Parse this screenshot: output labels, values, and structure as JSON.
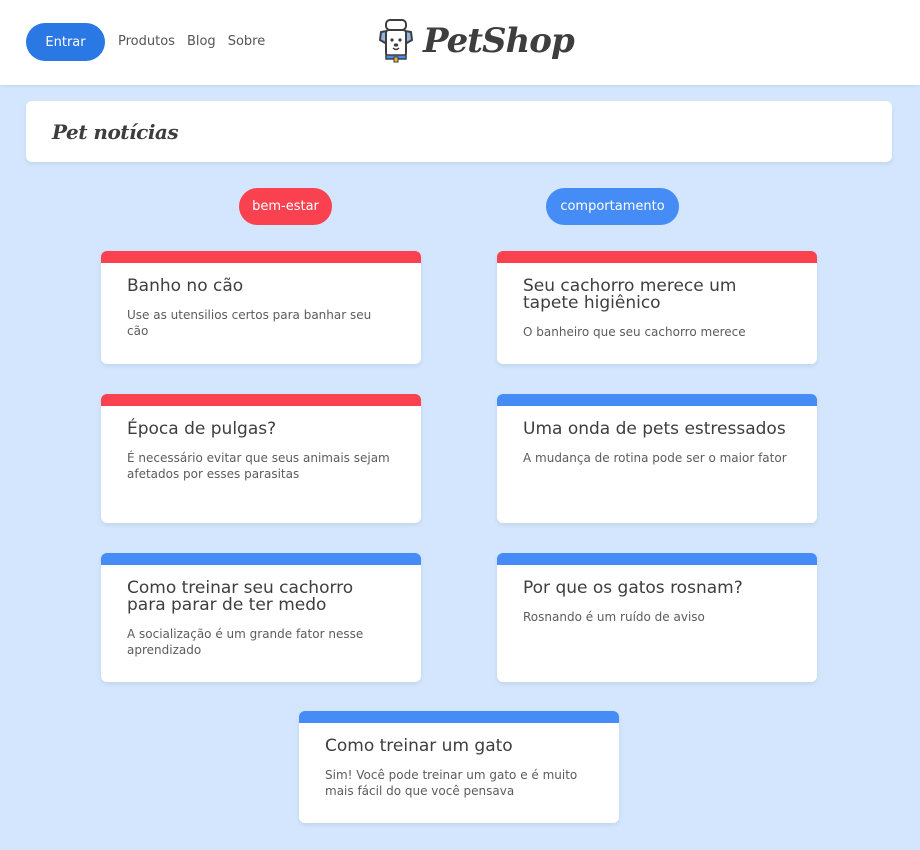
{
  "header": {
    "login_label": "Entrar",
    "nav": [
      "Produtos",
      "Blog",
      "Sobre"
    ],
    "brand": "PetShop"
  },
  "page": {
    "title": "Pet notícias"
  },
  "tags": [
    "bem-estar",
    "comportamento"
  ],
  "colors": {
    "background": "#d3e6fd",
    "primary_button": "#2a78e4",
    "red": "#f9414f",
    "blue": "#458cf6"
  },
  "cards": [
    {
      "title": "Banho no cão",
      "text": "Use as utensilios certos para banhar seu cão",
      "category": "bem-estar"
    },
    {
      "title": "Seu cachorro merece um tapete higiênico",
      "text": "O banheiro que seu cachorro merece",
      "category": "bem-estar"
    },
    {
      "title": "Época de pulgas?",
      "text": "É necessário evitar que seus animais sejam afetados por esses parasitas",
      "category": "bem-estar"
    },
    {
      "title": "Uma onda de pets estressados",
      "text": "A mudança de rotina pode ser o maior fator",
      "category": "comportamento"
    },
    {
      "title": "Como treinar seu cachorro para parar de ter medo",
      "text": "A socialização é um grande fator nesse aprendizado",
      "category": "comportamento"
    },
    {
      "title": "Por que os gatos rosnam?",
      "text": "Rosnando é um ruído de aviso",
      "category": "comportamento"
    },
    {
      "title": "Como treinar um gato",
      "text": "Sim! Você pode treinar um gato e é muito mais fácil do que você pensava",
      "category": "comportamento"
    }
  ]
}
